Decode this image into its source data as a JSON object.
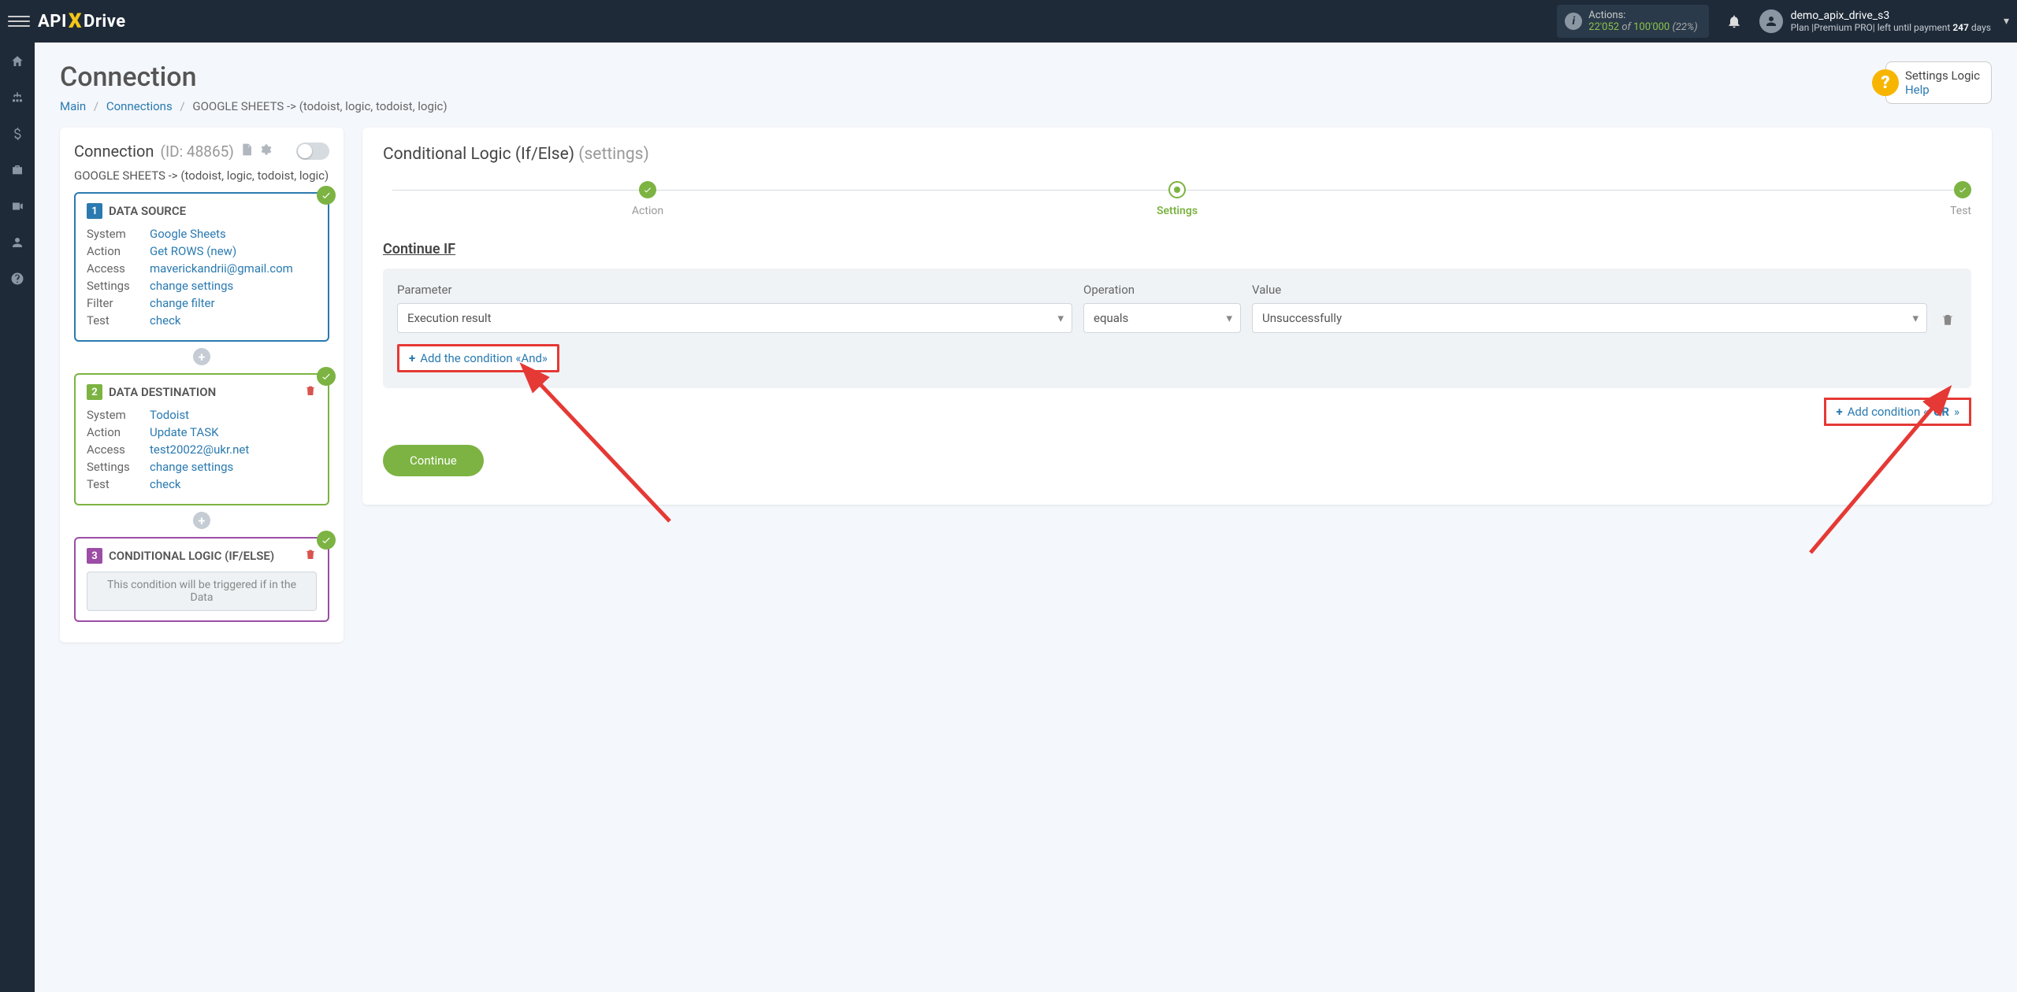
{
  "topbar": {
    "logo_api": "API",
    "logo_drive": "Drive",
    "actions_label": "Actions:",
    "actions_used": "22'052",
    "actions_of": "of",
    "actions_total": "100'000",
    "actions_pct": "(22%)",
    "user_name": "demo_apix_drive_s3",
    "user_plan_prefix": "Plan |Premium PRO| left until payment ",
    "user_plan_days_num": "247",
    "user_plan_days_suffix": " days"
  },
  "page": {
    "title": "Connection",
    "breadcrumb": {
      "main": "Main",
      "connections": "Connections",
      "current": "GOOGLE SHEETS -> (todoist, logic, todoist, logic)"
    },
    "help_title": "Settings Logic",
    "help_link": "Help"
  },
  "side": {
    "head_title": "Connection",
    "head_id": "(ID: 48865)",
    "subtitle": "GOOGLE SHEETS -> (todoist, logic, todoist, logic)",
    "card1": {
      "num": "1",
      "title": "DATA SOURCE",
      "rows": {
        "system": {
          "l": "System",
          "v": "Google Sheets"
        },
        "action": {
          "l": "Action",
          "v": "Get ROWS (new)"
        },
        "access": {
          "l": "Access",
          "v": "maverickandrii@gmail.com"
        },
        "settings": {
          "l": "Settings",
          "v": "change settings"
        },
        "filter": {
          "l": "Filter",
          "v": "change filter"
        },
        "test": {
          "l": "Test",
          "v": "check"
        }
      }
    },
    "card2": {
      "num": "2",
      "title": "DATA DESTINATION",
      "rows": {
        "system": {
          "l": "System",
          "v": "Todoist"
        },
        "action": {
          "l": "Action",
          "v": "Update TASK"
        },
        "access": {
          "l": "Access",
          "v": "test20022@ukr.net"
        },
        "settings": {
          "l": "Settings",
          "v": "change settings"
        },
        "test": {
          "l": "Test",
          "v": "check"
        }
      }
    },
    "card3": {
      "num": "3",
      "title": "CONDITIONAL LOGIC (IF/ELSE)",
      "note": "This condition will be triggered if in the Data"
    }
  },
  "main": {
    "title": "Conditional Logic (If/Else)",
    "title_sub": "(settings)",
    "steps": {
      "s1": "Action",
      "s2": "Settings",
      "s3": "Test"
    },
    "section": "Continue IF",
    "labels": {
      "param": "Parameter",
      "op": "Operation",
      "val": "Value"
    },
    "values": {
      "param": "Execution result",
      "op": "equals",
      "val": "Unsuccessfully"
    },
    "add_and": "Add the condition «And»",
    "add_or_pref": "Add condition «",
    "add_or_bold": "OR",
    "add_or_suf": "»",
    "continue": "Continue"
  }
}
